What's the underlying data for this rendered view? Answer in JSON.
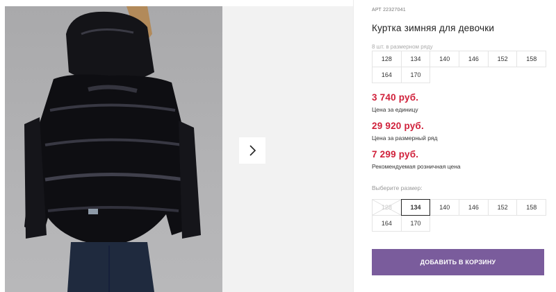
{
  "product": {
    "article_label": "АРТ",
    "article_number": "22327041",
    "title": "Куртка зимняя для девочки",
    "row_note": "8 шт. в размерном ряду",
    "row_sizes": [
      "128",
      "134",
      "140",
      "146",
      "152",
      "158",
      "164",
      "170"
    ]
  },
  "prices": {
    "unit_price": "3 740 руб.",
    "unit_caption": "Цена за единицу",
    "row_price": "29 920 руб.",
    "row_caption": "Цена за размерный ряд",
    "retail_price": "7 299 руб.",
    "retail_caption": "Рекомендуемая розничная цена"
  },
  "size_picker": {
    "label": "Выберите размер:",
    "sizes": [
      "128",
      "134",
      "140",
      "146",
      "152",
      "158",
      "164",
      "170"
    ],
    "selected": "134",
    "disabled": [
      "128"
    ]
  },
  "actions": {
    "add_to_cart": "ДОБАВИТЬ В КОРЗИНУ"
  },
  "gallery": {
    "next_icon": "chevron-right-icon"
  },
  "colors": {
    "price": "#d0203a",
    "button": "#7a5c9c"
  }
}
